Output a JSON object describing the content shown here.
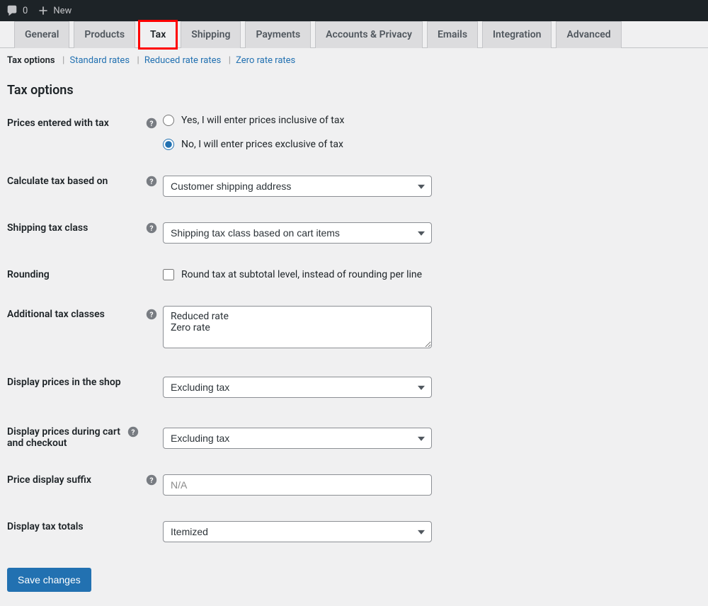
{
  "adminBar": {
    "commentCount": "0",
    "newLabel": "New"
  },
  "tabs": [
    {
      "label": "General"
    },
    {
      "label": "Products"
    },
    {
      "label": "Tax",
      "active": true
    },
    {
      "label": "Shipping"
    },
    {
      "label": "Payments"
    },
    {
      "label": "Accounts & Privacy"
    },
    {
      "label": "Emails"
    },
    {
      "label": "Integration"
    },
    {
      "label": "Advanced"
    }
  ],
  "subnav": {
    "current": "Tax options",
    "items": [
      "Standard rates",
      "Reduced rate rates",
      "Zero rate rates"
    ]
  },
  "sectionTitle": "Tax options",
  "fields": {
    "pricesEnteredWithTax": {
      "label": "Prices entered with tax",
      "opt1": "Yes, I will enter prices inclusive of tax",
      "opt2": "No, I will enter prices exclusive of tax"
    },
    "calculateTax": {
      "label": "Calculate tax based on",
      "value": "Customer shipping address"
    },
    "shippingTaxClass": {
      "label": "Shipping tax class",
      "value": "Shipping tax class based on cart items"
    },
    "rounding": {
      "label": "Rounding",
      "text": "Round tax at subtotal level, instead of rounding per line"
    },
    "additionalTaxClasses": {
      "label": "Additional tax classes",
      "value": "Reduced rate\nZero rate"
    },
    "displayShop": {
      "label": "Display prices in the shop",
      "value": "Excluding tax"
    },
    "displayCart": {
      "label": "Display prices during cart and checkout",
      "value": "Excluding tax"
    },
    "priceSuffix": {
      "label": "Price display suffix",
      "placeholder": "N/A",
      "value": ""
    },
    "displayTotals": {
      "label": "Display tax totals",
      "value": "Itemized"
    }
  },
  "saveLabel": "Save changes"
}
